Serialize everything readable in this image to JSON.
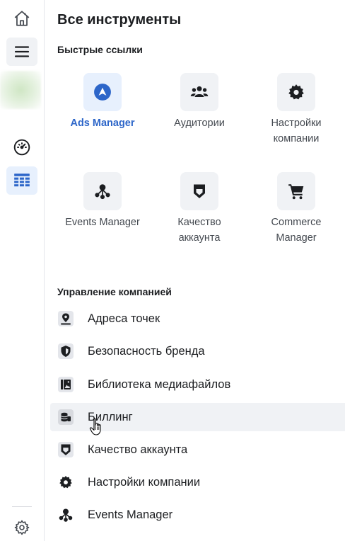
{
  "rail": {
    "icons": [
      "home-icon",
      "hamburger-menu-icon",
      "gauge-icon",
      "table-icon",
      "gear-icon"
    ]
  },
  "panel": {
    "title": "Все инструменты",
    "quick_links": {
      "heading": "Быстрые ссылки",
      "tiles": [
        {
          "label": "Ads Manager",
          "icon": "ads-manager-icon",
          "active": true
        },
        {
          "label": "Аудитории",
          "icon": "audiences-icon"
        },
        {
          "label": "Настройки компании",
          "icon": "settings-gear-icon"
        },
        {
          "label": "Events Manager",
          "icon": "events-manager-icon"
        },
        {
          "label": "Качество аккаунта",
          "icon": "shield-icon"
        },
        {
          "label": "Commerce Manager",
          "icon": "cart-icon"
        }
      ]
    },
    "business": {
      "heading": "Управление компанией",
      "items": [
        {
          "label": "Адреса точек",
          "icon": "map-pin-icon"
        },
        {
          "label": "Безопасность бренда",
          "icon": "brand-shield-icon"
        },
        {
          "label": "Библиотека медиафайлов",
          "icon": "media-library-icon"
        },
        {
          "label": "Биллинг",
          "icon": "billing-icon",
          "hovered": true
        },
        {
          "label": "Качество аккаунта",
          "icon": "account-quality-icon"
        },
        {
          "label": "Настройки компании",
          "icon": "company-settings-icon"
        },
        {
          "label": "Events Manager",
          "icon": "events-manager-icon"
        }
      ]
    }
  },
  "colors": {
    "accent": "#2d66c9",
    "hover": "#f0f2f5",
    "active_bg": "#e7f0fd"
  }
}
